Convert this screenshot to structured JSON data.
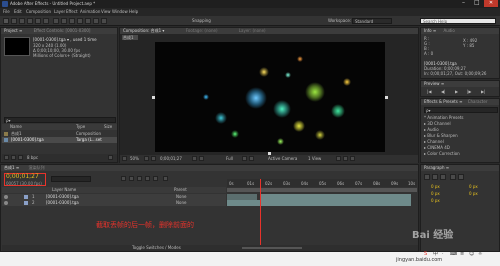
{
  "window": {
    "title": "Adobe After Effects - Untitled Project.aep *"
  },
  "menubar": {
    "items": [
      "File",
      "Edit",
      "Composition",
      "Layer",
      "Effect",
      "Animation",
      "View",
      "Window",
      "Help"
    ]
  },
  "toolbar": {
    "workspace_mode": "Snapping",
    "workspace_label": "Workspace:",
    "workspace_value": "Standard",
    "search_placeholder": "Search Help"
  },
  "project": {
    "tab": "Project ≡",
    "tab2": "Effect Controls: [0001-0300]",
    "item_name": "[0001-0300].tga ▾ , used 1 time",
    "item_info": [
      "320 x 240 (1.00)",
      "Δ 0;00;10;00, 30.00 fps",
      "Millions of Colors+ (Straight)"
    ],
    "search_placeholder": "ρ▾",
    "col_name": "Name",
    "col_type": "Type",
    "col_size": "Size",
    "rows": [
      {
        "name": "合成1",
        "type": "Composition"
      },
      {
        "name": "[0001-0300].tga",
        "type": "Targa (L...set"
      }
    ],
    "footer": "8 bpc"
  },
  "comp": {
    "tab": "Composition: 合成1 ▾",
    "tab2": "Footage: (none)",
    "tab3": "Layer: (none)",
    "breadcrumb": "合成1",
    "zoom": "50%",
    "time": "0;00;01;27",
    "quality": "Full",
    "camera": "Active Camera",
    "views": "1 View"
  },
  "info": {
    "tab": "Info ≡",
    "tab2": "Audio",
    "R": "R :",
    "G": "G :",
    "B": "B :",
    "A": "A : 0",
    "X": "X : 492",
    "Y": "Y : 85",
    "layer_name": "[0001-0300].tga",
    "duration": "Duration: 0;00;09;27",
    "in_out": "In: 0;00;01;27, Out: 0;00;09;26"
  },
  "preview": {
    "tab": "Preview ≡",
    "controls": [
      "|◀",
      "◀|",
      "▶",
      "|▶",
      "▶|"
    ]
  },
  "effects": {
    "tab": "Effects & Presets ≡",
    "tab2": "Character",
    "search_placeholder": "ρ▾",
    "items": [
      "* Animation Presets",
      "▸ 3D Channel",
      "▸ Audio",
      "▸ Blur & Sharpen",
      "▸ Channel",
      "▸ CINEMA 4D",
      "▸ Color Correction"
    ]
  },
  "paragraph": {
    "tab": "Paragraph ≡",
    "fields": [
      "0 px",
      "0 px",
      "0 px",
      "0 px",
      "0 px"
    ]
  },
  "timeline": {
    "tab": "合成1 ≡",
    "tab2": "渲染队列",
    "current_time": "0;00;01;27",
    "frame_info": "00057 (30.00 fps)",
    "col_source": "Layer Name",
    "col_mode": "Parent",
    "layers": [
      {
        "num": "1",
        "name": "[0001-0300].tga",
        "parent": "None"
      },
      {
        "num": "2",
        "name": "[0001-0300].tga",
        "parent": "None"
      }
    ],
    "ruler": [
      "0s",
      "01s",
      "02s",
      "03s",
      "04s",
      "05s",
      "06s",
      "07s",
      "08s",
      "09s",
      "10s"
    ],
    "footer": "Toggle Switches / Modes"
  },
  "annotation": {
    "text": "截取丢帧的后一帧，删除前面的"
  },
  "watermark": {
    "site": "jingyan.baidu.com",
    "logo": "Bai 经验"
  },
  "taskbar": {
    "items": [
      "S",
      "中",
      "·",
      "⌨",
      "≡",
      "☺",
      "☼"
    ]
  },
  "colors": {
    "annotation_red": "#e8332b",
    "timecode_yellow": "#e8c21e",
    "particle_green": "#9be640",
    "particle_cyan": "#3ec8d8"
  }
}
